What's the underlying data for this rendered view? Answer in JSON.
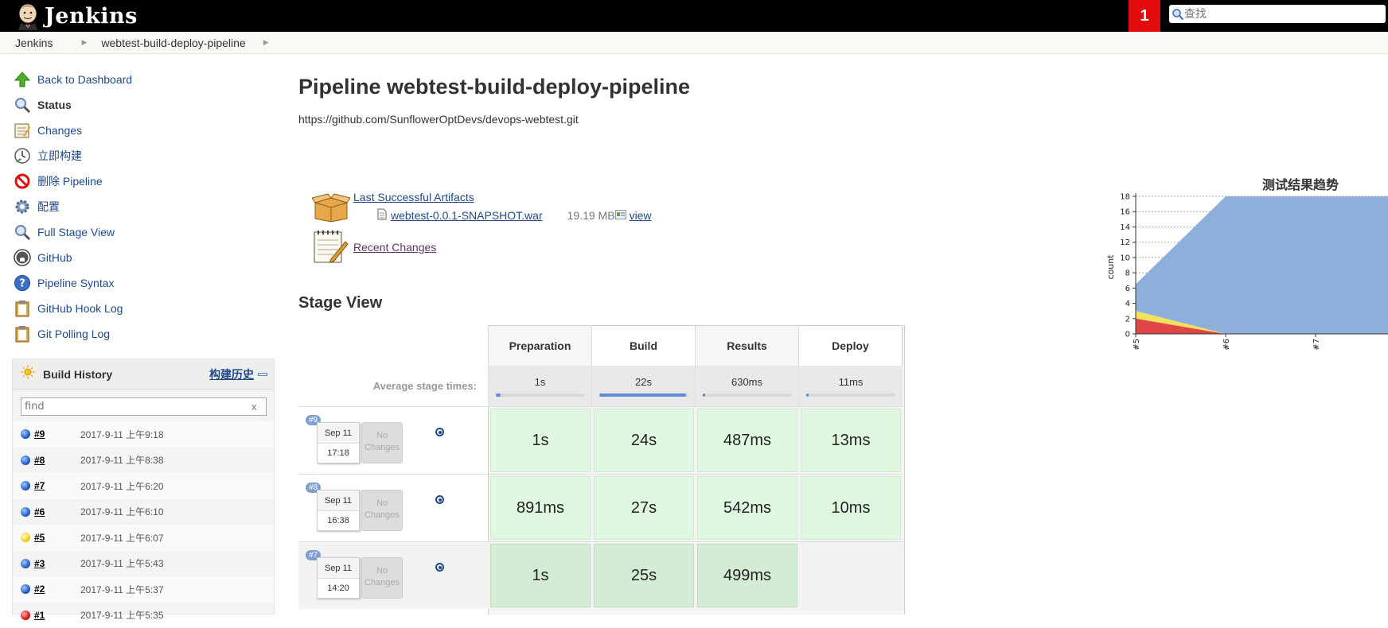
{
  "header": {
    "logo_text": "Jenkins",
    "notification_count": "1",
    "search_placeholder": "查找"
  },
  "breadcrumb": {
    "items": [
      "Jenkins",
      "webtest-build-deploy-pipeline"
    ]
  },
  "sidebar": {
    "tasks": [
      {
        "label": "Back to Dashboard",
        "icon": "up-arrow-icon"
      },
      {
        "label": "Status",
        "icon": "search-icon"
      },
      {
        "label": "Changes",
        "icon": "notepad-icon"
      },
      {
        "label": "立即构建",
        "icon": "clock-build-icon"
      },
      {
        "label": "删除 Pipeline",
        "icon": "no-entry-icon"
      },
      {
        "label": "配置",
        "icon": "gear-icon"
      },
      {
        "label": "Full Stage View",
        "icon": "search-icon"
      },
      {
        "label": "GitHub",
        "icon": "github-icon"
      },
      {
        "label": "Pipeline Syntax",
        "icon": "help-icon"
      },
      {
        "label": "GitHub Hook Log",
        "icon": "clipboard-icon"
      },
      {
        "label": "Git Polling Log",
        "icon": "clipboard-icon"
      }
    ]
  },
  "build_history": {
    "title": "Build History",
    "trend_link": "构建历史",
    "filter_placeholder": "find",
    "clear_label": "x",
    "builds": [
      {
        "num": "#9",
        "date": "2017-9-11 上午9:18",
        "status": "blue"
      },
      {
        "num": "#8",
        "date": "2017-9-11 上午8:38",
        "status": "blue"
      },
      {
        "num": "#7",
        "date": "2017-9-11 上午6:20",
        "status": "blue"
      },
      {
        "num": "#6",
        "date": "2017-9-11 上午6:10",
        "status": "blue"
      },
      {
        "num": "#5",
        "date": "2017-9-11 上午6:07",
        "status": "yellow"
      },
      {
        "num": "#3",
        "date": "2017-9-11 上午5:43",
        "status": "blue"
      },
      {
        "num": "#2",
        "date": "2017-9-11 上午5:37",
        "status": "blue"
      },
      {
        "num": "#1",
        "date": "2017-9-11 上午5:35",
        "status": "red"
      }
    ]
  },
  "main": {
    "title": "Pipeline webtest-build-deploy-pipeline",
    "repo_url": "https://github.com/SunflowerOptDevs/devops-webtest.git",
    "artifacts_link": "Last Successful Artifacts",
    "artifact_file": "webtest-0.0.1-SNAPSHOT.war",
    "artifact_size": "19.19 MB",
    "artifact_view": "view",
    "recent_changes": "Recent Changes",
    "stage_view_title": "Stage View"
  },
  "stage_view": {
    "avg_label": "Average stage times:",
    "stages": [
      {
        "name": "Preparation",
        "avg": "1s",
        "avg_fraction": 0.05
      },
      {
        "name": "Build",
        "avg": "22s",
        "avg_fraction": 0.97
      },
      {
        "name": "Results",
        "avg": "630ms",
        "avg_fraction": 0.03
      },
      {
        "name": "Deploy",
        "avg": "11ms",
        "avg_fraction": 0.01
      }
    ],
    "runs": [
      {
        "tag": "#9",
        "date": "Sep 11",
        "time": "17:18",
        "no_changes": "No Changes",
        "times": [
          "1s",
          "24s",
          "487ms",
          "13ms"
        ]
      },
      {
        "tag": "#8",
        "date": "Sep 11",
        "time": "16:38",
        "no_changes": "No Changes",
        "times": [
          "891ms",
          "27s",
          "542ms",
          "10ms"
        ]
      },
      {
        "tag": "#7",
        "date": "Sep 11",
        "time": "14:20",
        "no_changes": "No Changes",
        "times": [
          "1s",
          "25s",
          "499ms",
          ""
        ]
      }
    ]
  },
  "chart_data": {
    "type": "area",
    "title": "测试结果趋势",
    "ylabel": "count",
    "x": [
      "#5",
      "#6",
      "#7"
    ],
    "yticks": [
      "0",
      "2",
      "4",
      "6",
      "8",
      "10",
      "12",
      "14",
      "16",
      "18"
    ],
    "ylim": [
      0,
      18
    ],
    "series": [
      {
        "color": "#e04646",
        "values": [
          2,
          0,
          0
        ]
      },
      {
        "color": "#f2e15a",
        "values": [
          1,
          0,
          0
        ]
      },
      {
        "color": "#8eaedc",
        "values": [
          3.5,
          18,
          18
        ]
      }
    ]
  }
}
